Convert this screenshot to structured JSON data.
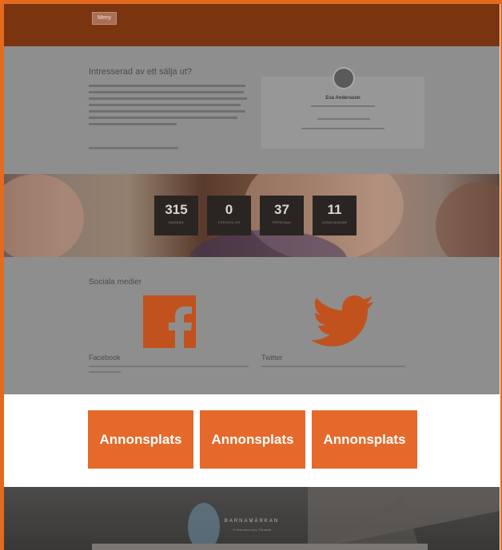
{
  "header": {
    "nav_label": "Meny"
  },
  "interest": {
    "title": "Intresserad av ett sälja ut?"
  },
  "contact": {
    "name": "Eva Andersson"
  },
  "stats": [
    {
      "value": "315",
      "label": "BARNEN"
    },
    {
      "value": "0",
      "label": "FÖRSKOLOR"
    },
    {
      "value": "37",
      "label": "PERSONAL"
    },
    {
      "value": "11",
      "label": "AVDELNINGAR"
    }
  ],
  "social": {
    "title": "Sociala medier",
    "facebook": {
      "label": "Facebook",
      "icon": "facebook-icon"
    },
    "twitter": {
      "label": "Twitter",
      "icon": "twitter-icon"
    }
  },
  "ads": [
    {
      "label": "Annonsplats"
    },
    {
      "label": "Annonsplats"
    },
    {
      "label": "Annonsplats"
    }
  ],
  "footer": {
    "title": "BARNAMÄRKAN",
    "subtitle": "Vi finns även hos: Förskola"
  },
  "colors": {
    "brand_dark": "#7a3510",
    "accent": "#e4692b",
    "frame": "#e36a1f"
  }
}
